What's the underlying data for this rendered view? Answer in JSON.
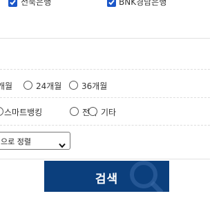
{
  "banks": [
    {
      "label": "전북은행",
      "checked": true
    },
    {
      "label": "BNK경남은행",
      "checked": true
    }
  ],
  "period": {
    "options": [
      {
        "label": "개월",
        "selected": false
      },
      {
        "label": "24개월",
        "selected": false
      },
      {
        "label": "36개월",
        "selected": false
      }
    ]
  },
  "channel": {
    "options": [
      {
        "label": "스마트뱅킹",
        "selected": false
      },
      {
        "label": "전화",
        "selected": false
      },
      {
        "label": "기타",
        "selected": false
      }
    ]
  },
  "sort": {
    "selected": "으로 정렬"
  },
  "search_button": {
    "label": "검색"
  },
  "colors": {
    "accent": "#1a56c8",
    "button": "#0b3f7d"
  }
}
